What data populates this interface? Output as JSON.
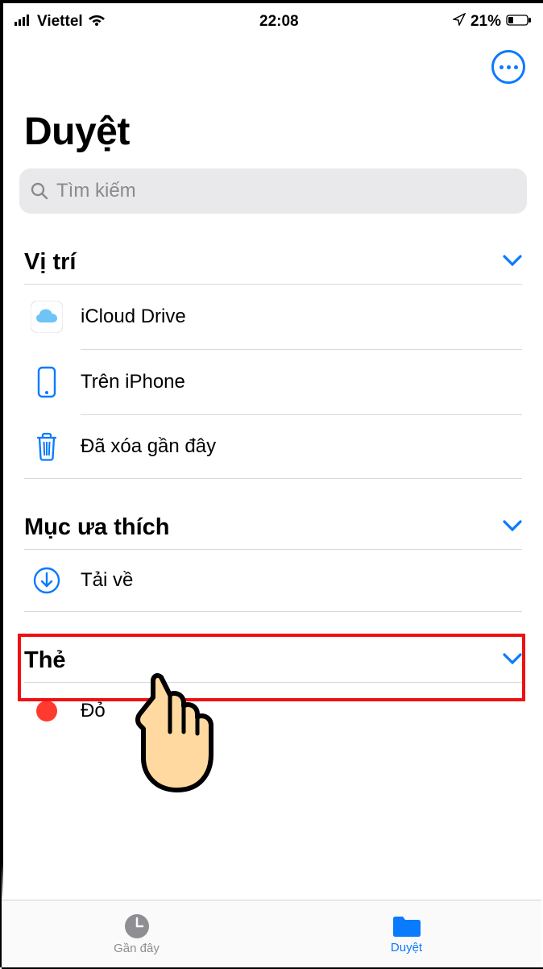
{
  "status": {
    "carrier": "Viettel",
    "time": "22:08",
    "battery": "21%"
  },
  "toolbar": {
    "more": "more"
  },
  "page_title": "Duyệt",
  "search": {
    "placeholder": "Tìm kiếm"
  },
  "sections": {
    "locations": {
      "title": "Vị trí",
      "items": [
        {
          "label": "iCloud Drive",
          "icon": "icloud"
        },
        {
          "label": "Trên iPhone",
          "icon": "iphone"
        },
        {
          "label": "Đã xóa gần đây",
          "icon": "trash"
        }
      ]
    },
    "favorites": {
      "title": "Mục ưa thích",
      "items": [
        {
          "label": "Tải về",
          "icon": "download"
        }
      ]
    },
    "tags": {
      "title": "Thẻ",
      "items": [
        {
          "label": "Đỏ",
          "icon": "red-dot"
        }
      ]
    }
  },
  "tabs": {
    "recents": "Gần đây",
    "browse": "Duyệt"
  }
}
